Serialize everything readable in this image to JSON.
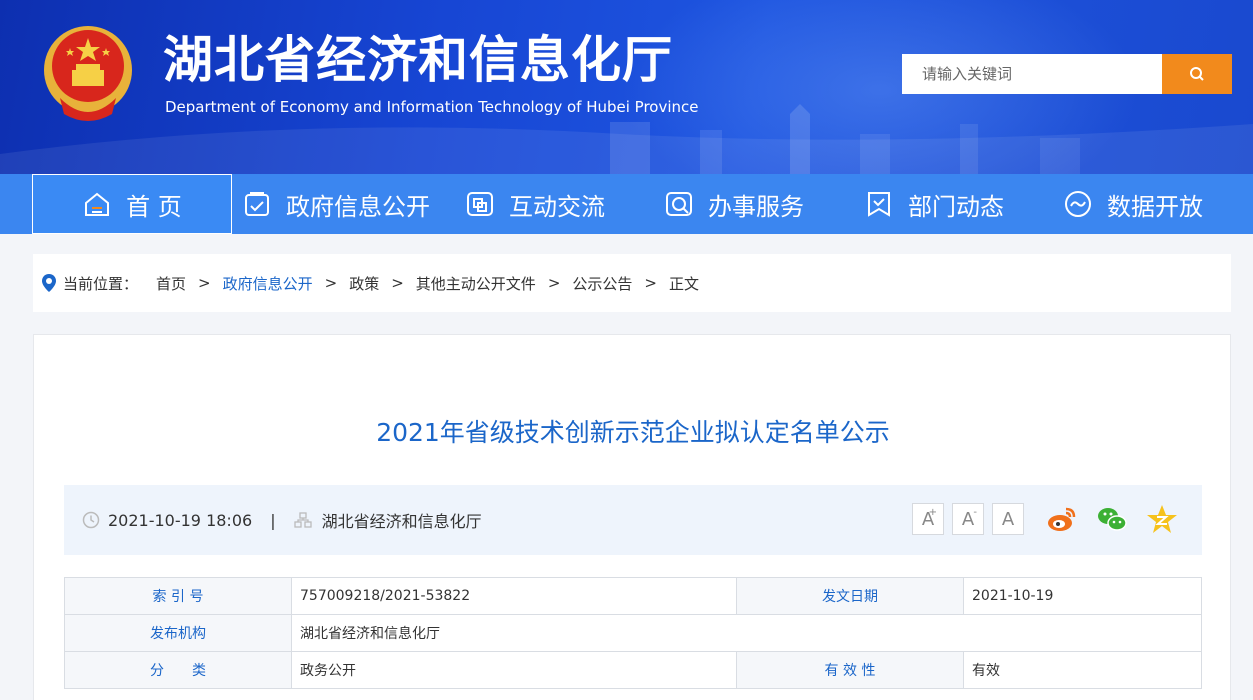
{
  "header": {
    "title": "湖北省经济和信息化厅",
    "subtitle": "Department of Economy and Information Technology of Hubei Province",
    "search_placeholder": "请输入关键词"
  },
  "nav": {
    "items": [
      {
        "label": "首 页",
        "icon": "home-icon"
      },
      {
        "label": "政府信息公开",
        "icon": "document-check-icon"
      },
      {
        "label": "互动交流",
        "icon": "chat-squares-icon"
      },
      {
        "label": "办事服务",
        "icon": "service-search-icon"
      },
      {
        "label": "部门动态",
        "icon": "bookmark-icon"
      },
      {
        "label": "数据开放",
        "icon": "wave-circle-icon"
      }
    ]
  },
  "breadcrumb": {
    "prefix": "当前位置：",
    "items": [
      "首页",
      "政府信息公开",
      "政策",
      "其他主动公开文件",
      "公示公告",
      "正文"
    ],
    "separator": ">"
  },
  "article": {
    "title": "2021年省级技术创新示范企业拟认定名单公示",
    "datetime": "2021-10-19 18:06",
    "divider": "|",
    "publisher": "湖北省经济和信息化厅",
    "font_sizes": [
      "A",
      "A",
      "A"
    ],
    "share_icons": [
      "weibo-icon",
      "wechat-icon",
      "qzone-star-icon"
    ]
  },
  "info_table": {
    "index_label": "索 引 号",
    "index_value": "757009218/2021-53822",
    "date_label": "发文日期",
    "date_value": "2021-10-19",
    "org_label": "发布机构",
    "org_value": "湖北省经济和信息化厅",
    "category_label": "分　　类",
    "category_value": "政务公开",
    "validity_label": "有 效 性",
    "validity_value": "有效"
  },
  "colors": {
    "header_blue": "#1746d4",
    "nav_blue": "#3b86f0",
    "accent_orange": "#f28a1c",
    "link_blue": "#1b66c9"
  }
}
